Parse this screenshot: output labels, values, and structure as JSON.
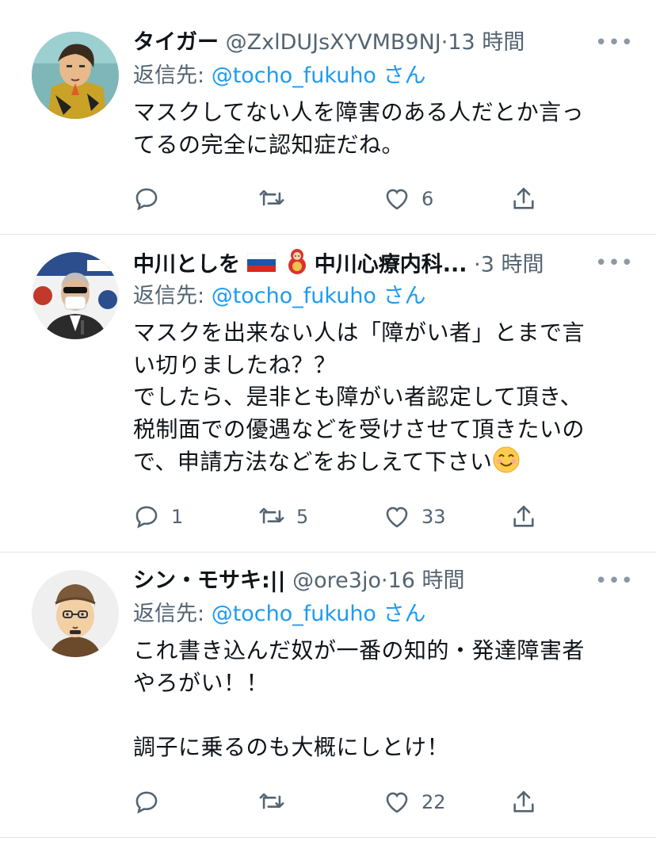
{
  "tweets": [
    {
      "name": "タイガー",
      "handle": "@ZxlDUJsXYVMB9NJ",
      "dot": "·",
      "time": "13 時間",
      "more": "•••",
      "reply_label": "返信先:",
      "reply_mention": "@tocho_fukuho",
      "reply_suffix": "さん",
      "body": "マスクしてない人を障害のある人だとか言っ\nてるの完全に認知症だね。",
      "reply_count": "",
      "retweet_count": "",
      "like_count": "6"
    },
    {
      "name": "中川としを",
      "name_flag": "russia-flag",
      "name_emoji": "nesting-doll",
      "name_rest": "中川心療内科...",
      "dot": "·",
      "time": "3 時間",
      "more": "•••",
      "reply_label": "返信先:",
      "reply_mention": "@tocho_fukuho",
      "reply_suffix": "さん",
      "body": "マスクを出来ない人は「障がい者」とまで言\nい切りましたね？？\nでしたら、是非とも障がい者認定して頂き、\n税制面での優遇などを受けさせて頂きたいの\nで、申請方法などをおしえて下さい",
      "body_emoji": "smiling-face",
      "reply_count": "1",
      "retweet_count": "5",
      "like_count": "33"
    },
    {
      "name": "シン・モサキ:||",
      "handle": "@ore3jo",
      "dot": "·",
      "time": "16 時間",
      "more": "•••",
      "reply_label": "返信先:",
      "reply_mention": "@tocho_fukuho",
      "reply_suffix": "さん",
      "body": "これ書き込んだ奴が一番の知的・発達障害者\nやろがい！！\n\n調子に乗るのも大概にしとけ！",
      "reply_count": "",
      "retweet_count": "",
      "like_count": "22"
    }
  ],
  "icons": [
    "reply-icon",
    "retweet-icon",
    "like-icon",
    "share-icon"
  ],
  "colors": {
    "link": "#1d9bf0",
    "secondary": "#536471",
    "divider": "#e1e6ea"
  }
}
